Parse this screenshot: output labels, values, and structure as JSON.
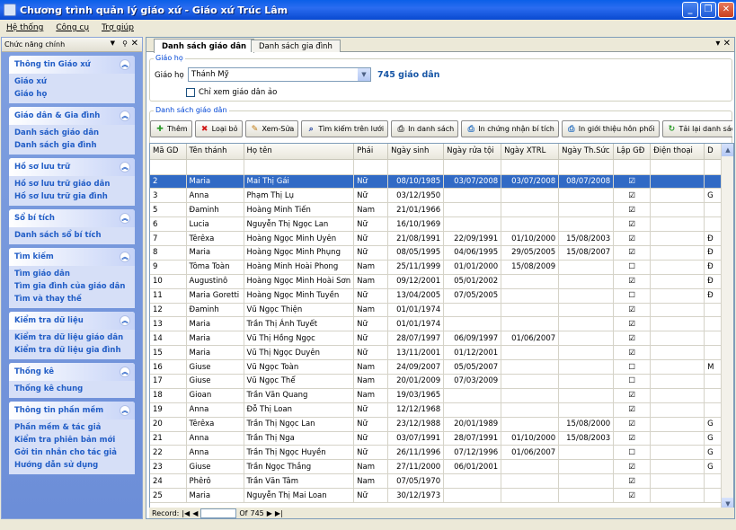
{
  "window": {
    "title": "Chương trình quản lý giáo xứ - Giáo xứ Trúc Lâm"
  },
  "menu": [
    "Hệ thống",
    "Công cụ",
    "Trợ giúp"
  ],
  "panel": {
    "title": "Chức năng chính",
    "groups": [
      {
        "title": "Thông tin Giáo xứ",
        "items": [
          "Giáo xứ",
          "Giáo họ"
        ]
      },
      {
        "title": "Giáo dân & Gia đình",
        "items": [
          "Danh sách giáo dân",
          "Danh sách gia đình"
        ]
      },
      {
        "title": "Hồ sơ lưu trữ",
        "items": [
          "Hồ sơ lưu trữ giáo dân",
          "Hồ sơ lưu trữ gia đình"
        ]
      },
      {
        "title": "Sổ bí tích",
        "items": [
          "Danh sách sổ bí tích"
        ]
      },
      {
        "title": "Tìm kiếm",
        "items": [
          "Tìm giáo dân",
          "Tìm gia đình của giáo dân",
          "Tìm và thay thế"
        ]
      },
      {
        "title": "Kiểm tra dữ liệu",
        "items": [
          "Kiểm tra dữ liệu giáo dân",
          "Kiểm tra dữ liệu gia đình"
        ]
      },
      {
        "title": "Thống kê",
        "items": [
          "Thống kê chung"
        ]
      },
      {
        "title": "Thông tin phần mềm",
        "items": [
          "Phần mềm & tác giả",
          "Kiểm tra phiên bản mới",
          "Gởi tin nhắn cho tác giả",
          "Hướng dẫn sử dụng"
        ]
      }
    ]
  },
  "tabs": [
    "Danh sách giáo dân",
    "Danh sách gia đình"
  ],
  "filter": {
    "legend": "Giáo họ",
    "label": "Giáo họ",
    "value": "Thánh Mỹ",
    "count": "745 giáo dân",
    "only_virtual": "Chỉ xem giáo dân ảo"
  },
  "list_legend": "Danh sách giáo dân",
  "toolbar": [
    "Thêm",
    "Loại bỏ",
    "Xem-Sửa",
    "Tìm kiếm trên lưới",
    "In danh sách",
    "In chứng nhận bí tích",
    "In giới thiệu hôn phối",
    "Tải lại danh sách"
  ],
  "columns": [
    "Mã GD",
    "Tên thánh",
    "Họ tên",
    "Phái",
    "Ngày sinh",
    "Ngày rửa tội",
    "Ngày XTRL",
    "Ngày Th.Sức",
    "Lập GĐ",
    "Điện thoại",
    "D"
  ],
  "rows": [
    [
      "2",
      "Maria",
      "Mai Thị Gái",
      "Nữ",
      "08/10/1985",
      "03/07/2008",
      "03/07/2008",
      "08/07/2008",
      "☑",
      "",
      ""
    ],
    [
      "3",
      "Anna",
      "Phạm Thị Lụ",
      "Nữ",
      "03/12/1950",
      "",
      "",
      "",
      "☑",
      "",
      "G"
    ],
    [
      "5",
      "Đaminh",
      "Hoàng Minh Tiến",
      "Nam",
      "21/01/1966",
      "",
      "",
      "",
      "☑",
      "",
      ""
    ],
    [
      "6",
      "Lucia",
      "Nguyễn Thị Ngọc Lan",
      "Nữ",
      "16/10/1969",
      "",
      "",
      "",
      "☑",
      "",
      ""
    ],
    [
      "7",
      "Têrêxa",
      "Hoàng Ngọc Minh Uyên",
      "Nữ",
      "21/08/1991",
      "22/09/1991",
      "01/10/2000",
      "15/08/2003",
      "☑",
      "",
      "Đ"
    ],
    [
      "8",
      "Maria",
      "Hoàng Ngọc Minh Phụng",
      "Nữ",
      "08/05/1995",
      "04/06/1995",
      "29/05/2005",
      "15/08/2007",
      "☑",
      "",
      "Đ"
    ],
    [
      "9",
      "Tôma Toàn",
      "Hoàng Minh Hoài Phong",
      "Nam",
      "25/11/1999",
      "01/01/2000",
      "15/08/2009",
      "",
      "☐",
      "",
      "Đ"
    ],
    [
      "10",
      "Augustinô",
      "Hoàng Ngọc Minh Hoài Sơn",
      "Nam",
      "09/12/2001",
      "05/01/2002",
      "",
      "",
      "☑",
      "",
      "Đ"
    ],
    [
      "11",
      "Maria Goretti",
      "Hoàng Ngọc Minh Tuyền",
      "Nữ",
      "13/04/2005",
      "07/05/2005",
      "",
      "",
      "☐",
      "",
      "Đ"
    ],
    [
      "12",
      "Đaminh",
      "Vũ Ngọc Thiện",
      "Nam",
      "01/01/1974",
      "",
      "",
      "",
      "☑",
      "",
      ""
    ],
    [
      "13",
      "Maria",
      "Trần Thị Ánh Tuyết",
      "Nữ",
      "01/01/1974",
      "",
      "",
      "",
      "☑",
      "",
      ""
    ],
    [
      "14",
      "Maria",
      "Vũ Thị Hồng Ngọc",
      "Nữ",
      "28/07/1997",
      "06/09/1997",
      "01/06/2007",
      "",
      "☑",
      "",
      ""
    ],
    [
      "15",
      "Maria",
      "Vũ Thị Ngọc Duyên",
      "Nữ",
      "13/11/2001",
      "01/12/2001",
      "",
      "",
      "☑",
      "",
      ""
    ],
    [
      "16",
      "Giuse",
      "Vũ Ngọc Toàn",
      "Nam",
      "24/09/2007",
      "05/05/2007",
      "",
      "",
      "☐",
      "",
      "M"
    ],
    [
      "17",
      "Giuse",
      "Vũ Ngọc Thể",
      "Nam",
      "20/01/2009",
      "07/03/2009",
      "",
      "",
      "☐",
      "",
      ""
    ],
    [
      "18",
      "Gioan",
      "Trần Văn Quang",
      "Nam",
      "19/03/1965",
      "",
      "",
      "",
      "☑",
      "",
      ""
    ],
    [
      "19",
      "Anna",
      "Đỗ Thị Loan",
      "Nữ",
      "12/12/1968",
      "",
      "",
      "",
      "☑",
      "",
      ""
    ],
    [
      "20",
      "Têrêxa",
      "Trần Thị Ngọc Lan",
      "Nữ",
      "23/12/1988",
      "20/01/1989",
      "",
      "15/08/2000",
      "☑",
      "",
      "G"
    ],
    [
      "21",
      "Anna",
      "Trần Thị Nga",
      "Nữ",
      "03/07/1991",
      "28/07/1991",
      "01/10/2000",
      "15/08/2003",
      "☑",
      "",
      "G"
    ],
    [
      "22",
      "Anna",
      "Trần Thị Ngọc Huyền",
      "Nữ",
      "26/11/1996",
      "07/12/1996",
      "01/06/2007",
      "",
      "☐",
      "",
      "G"
    ],
    [
      "23",
      "Giuse",
      "Trần Ngọc Thắng",
      "Nam",
      "27/11/2000",
      "06/01/2001",
      "",
      "",
      "☑",
      "",
      "G"
    ],
    [
      "24",
      "Phêrô",
      "Trần Văn Tâm",
      "Nam",
      "07/05/1970",
      "",
      "",
      "",
      "☑",
      "",
      ""
    ],
    [
      "25",
      "Maria",
      "Nguyễn Thị Mai Loan",
      "Nữ",
      "30/12/1973",
      "",
      "",
      "",
      "☑",
      "",
      ""
    ]
  ],
  "status": {
    "label": "Record:",
    "current": "",
    "of": "Of",
    "total": "745"
  }
}
